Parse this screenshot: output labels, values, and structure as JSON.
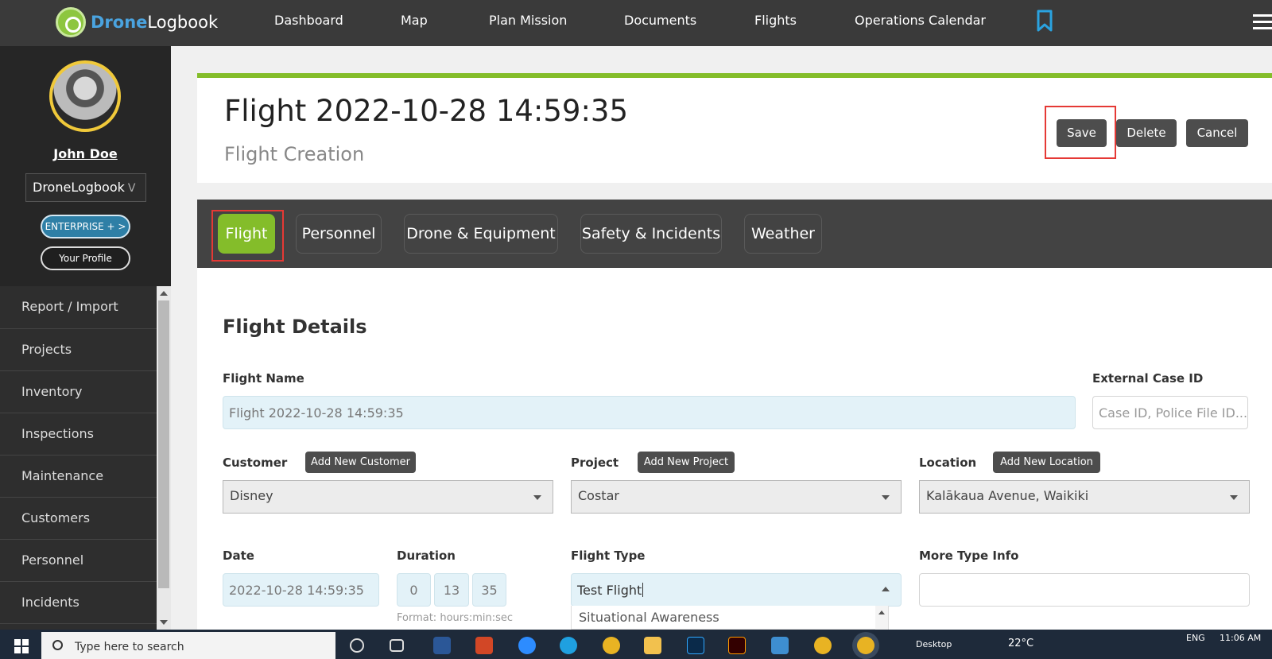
{
  "app": {
    "logo_bold": "Drone",
    "logo_rest": "Logbook"
  },
  "nav": {
    "items": [
      "Dashboard",
      "Map",
      "Plan Mission",
      "Documents",
      "Flights",
      "Operations Calendar"
    ]
  },
  "sidebar": {
    "user_name": "John Doe",
    "org": "DroneLogbook",
    "org_chevron": "V",
    "enterprise_label": "ENTERPRISE + >",
    "profile_label": "Your Profile",
    "menu": [
      "Report / Import",
      "Projects",
      "Inventory",
      "Inspections",
      "Maintenance",
      "Customers",
      "Personnel",
      "Incidents"
    ]
  },
  "header": {
    "title": "Flight 2022-10-28 14:59:35",
    "subtitle": "Flight Creation",
    "save_label": "Save",
    "delete_label": "Delete",
    "cancel_label": "Cancel"
  },
  "tabs": [
    "Flight",
    "Personnel",
    "Drone & Equipment",
    "Safety & Incidents",
    "Weather"
  ],
  "form": {
    "section_title": "Flight Details",
    "flight_name_label": "Flight Name",
    "flight_name_value": "Flight 2022-10-28 14:59:35",
    "external_id_label": "External Case ID",
    "external_id_placeholder": "Case ID, Police File ID...",
    "customer_label": "Customer",
    "add_customer_label": "Add New Customer",
    "customer_value": "Disney",
    "project_label": "Project",
    "add_project_label": "Add New Project",
    "project_value": "Costar",
    "location_label": "Location",
    "add_location_label": "Add New Location",
    "location_value": "Kalākaua Avenue, Waikiki",
    "date_label": "Date",
    "date_value": "2022-10-28 14:59:35",
    "duration_label": "Duration",
    "duration_hours": "0",
    "duration_min": "13",
    "duration_sec": "35",
    "duration_hint": "Format: hours:min:sec",
    "flight_type_label": "Flight Type",
    "flight_type_value": "Test Flight",
    "flight_type_option": "Situational Awareness",
    "more_type_label": "More Type Info"
  },
  "taskbar": {
    "search_placeholder": "Type here to search",
    "desktop_label": "Desktop",
    "temperature": "22°C",
    "language": "ENG",
    "time": "11:06 AM"
  },
  "colors": {
    "accent_green": "#84bd2a",
    "brand_blue": "#4aa3df",
    "highlight_red": "#e53935"
  }
}
